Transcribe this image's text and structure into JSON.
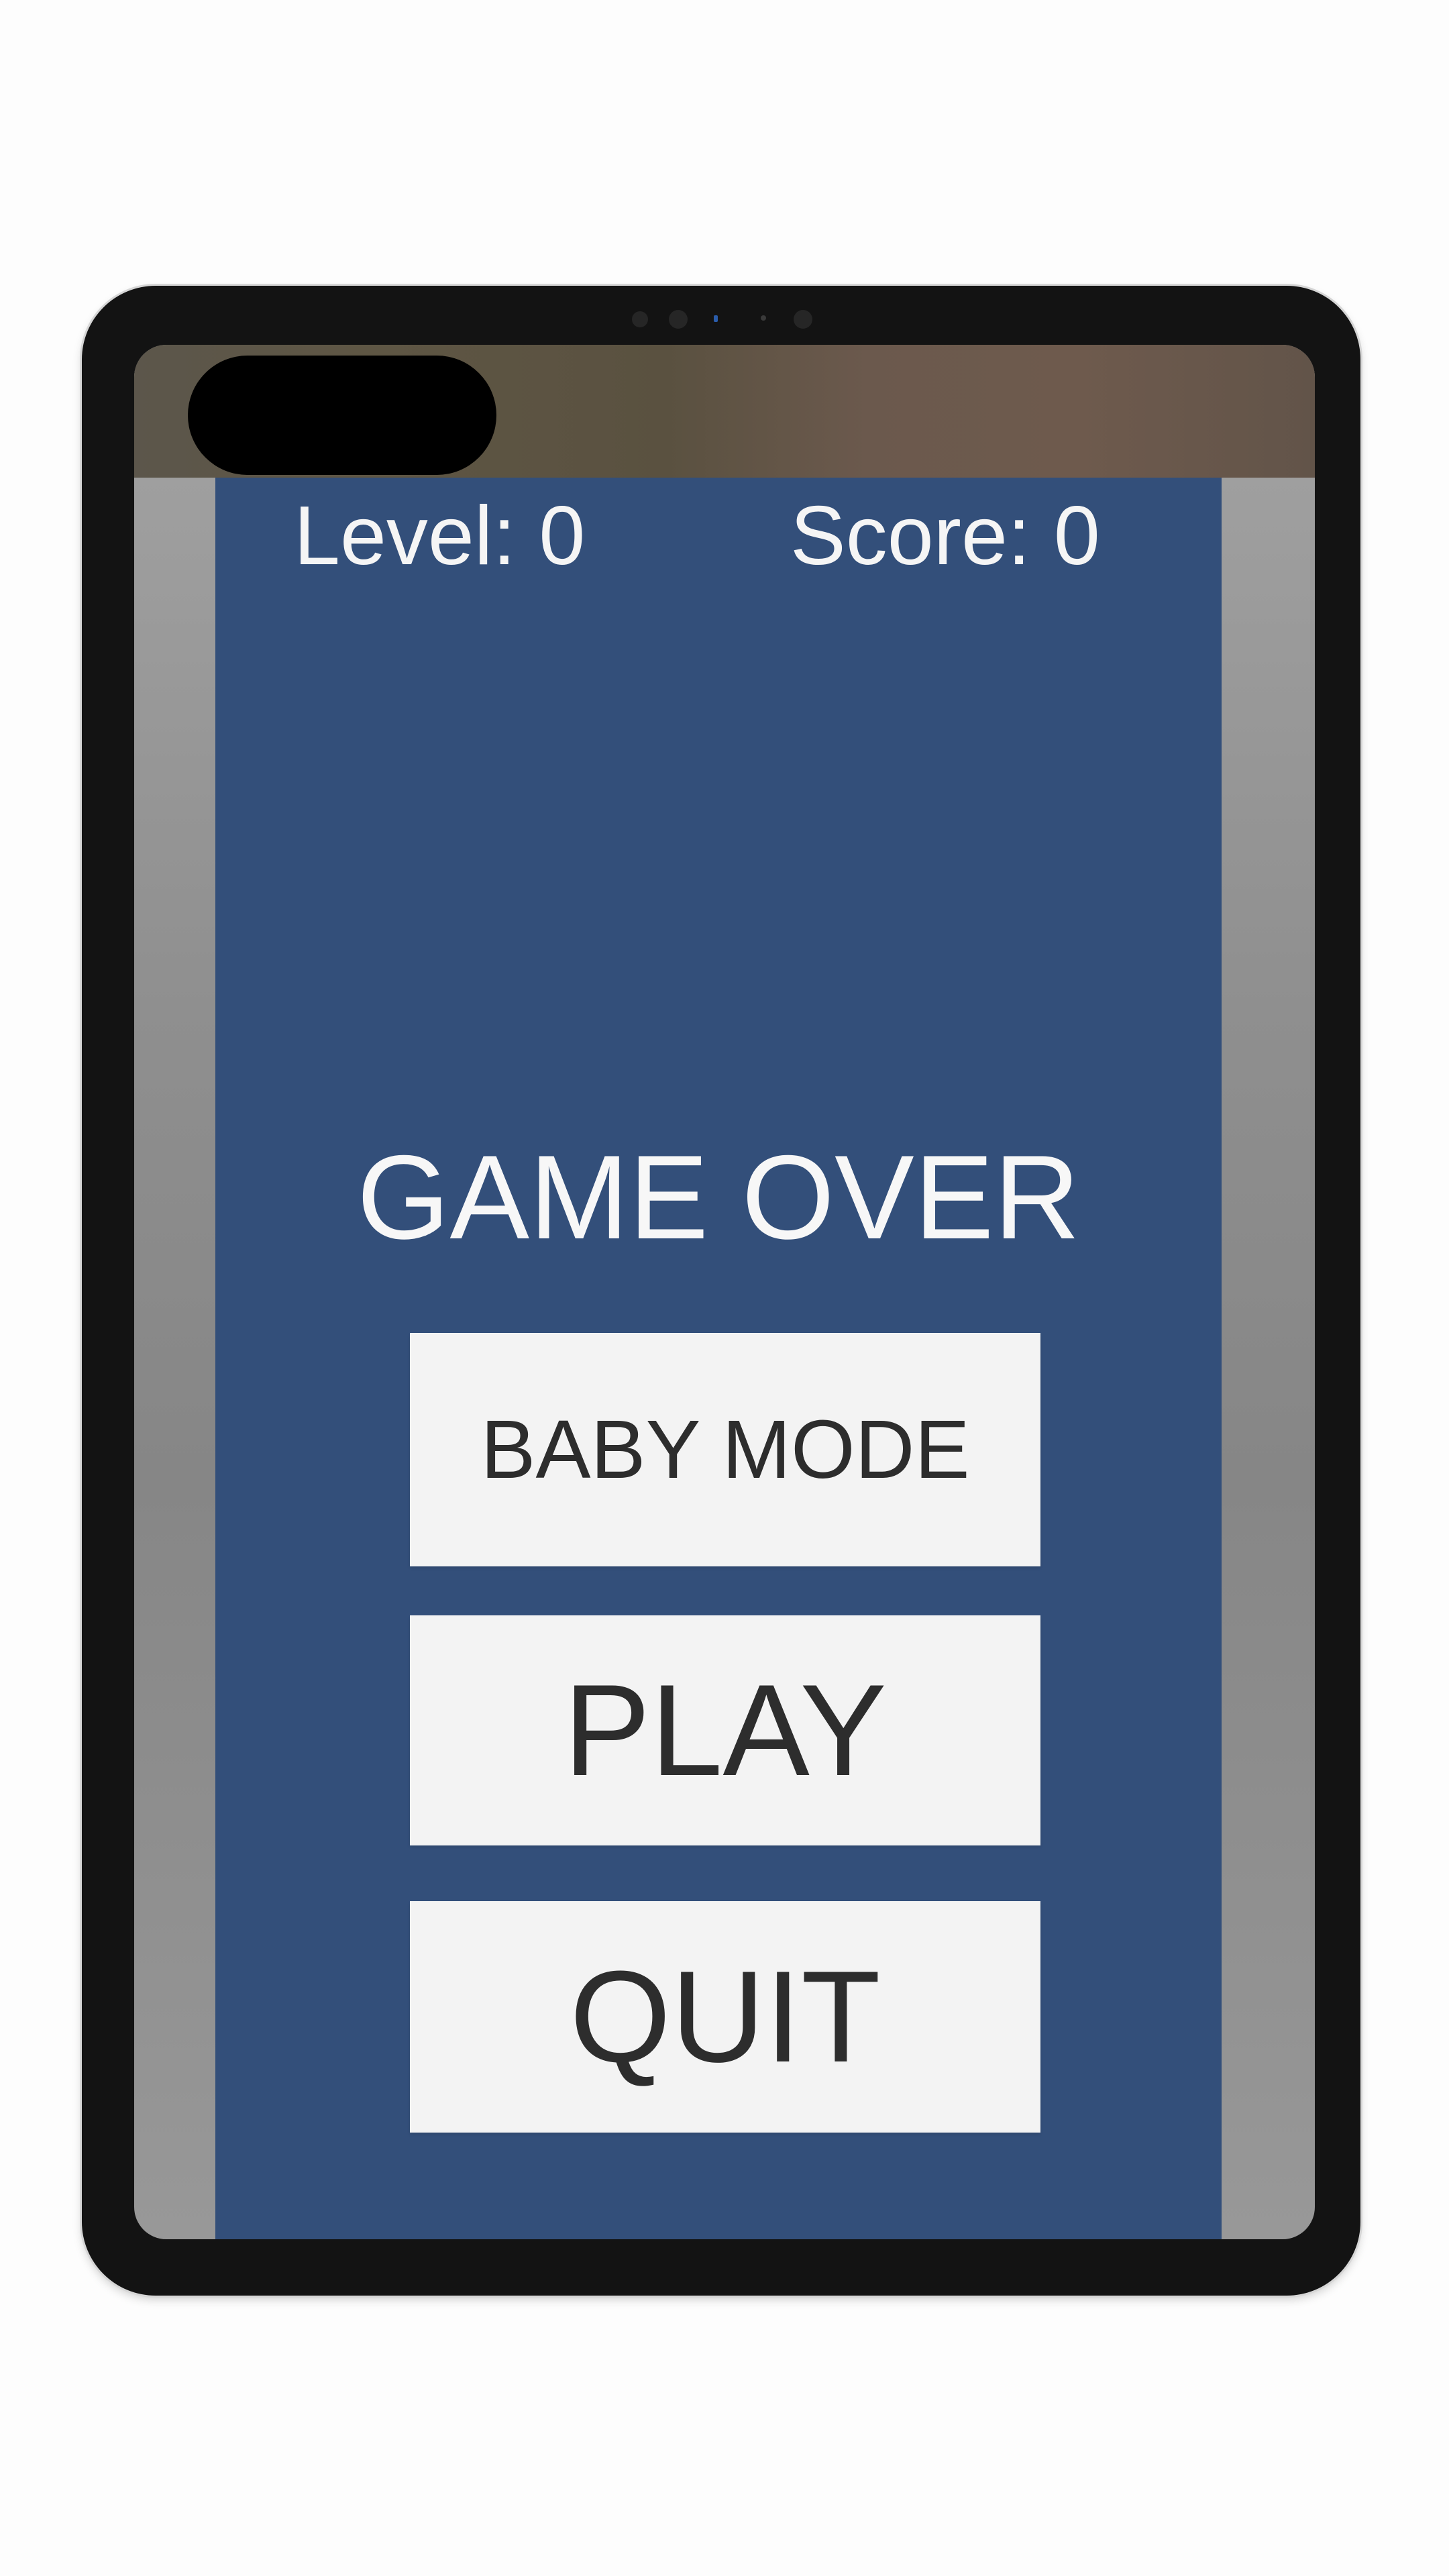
{
  "hud": {
    "level_text": "Level: 0",
    "score_text": "Score: 0"
  },
  "title": "GAME OVER",
  "buttons": {
    "baby_mode": "BABY MODE",
    "play": "PLAY",
    "quit": "QUIT"
  },
  "colors": {
    "panel": "#334f7a",
    "button": "#f3f3f3",
    "text_light": "#f5f5f5",
    "text_dark": "#2d2d2d",
    "device_frame": "#131313"
  }
}
